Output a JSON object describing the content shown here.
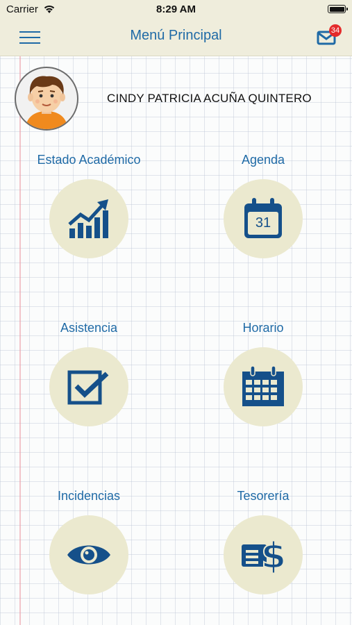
{
  "status_bar": {
    "carrier": "Carrier",
    "time": "8:29 AM"
  },
  "nav": {
    "title": "Menú Principal",
    "unread_count": "34"
  },
  "profile": {
    "name": "CINDY PATRICIA ACUÑA QUINTERO"
  },
  "menu": [
    {
      "label": "Estado Académico",
      "icon": "chart-growth-icon"
    },
    {
      "label": "Agenda",
      "icon": "calendar-day-icon",
      "day": "31"
    },
    {
      "label": "Asistencia",
      "icon": "checkbox-icon"
    },
    {
      "label": "Horario",
      "icon": "schedule-calendar-icon"
    },
    {
      "label": "Incidencias",
      "icon": "eye-icon"
    },
    {
      "label": "Tesorería",
      "icon": "money-bill-icon"
    }
  ],
  "colors": {
    "accent": "#1f6aa6",
    "icon": "#15508a",
    "tile_bg": "#ebe9cf",
    "header_bg": "#efeddc",
    "badge": "#e42b2b"
  }
}
